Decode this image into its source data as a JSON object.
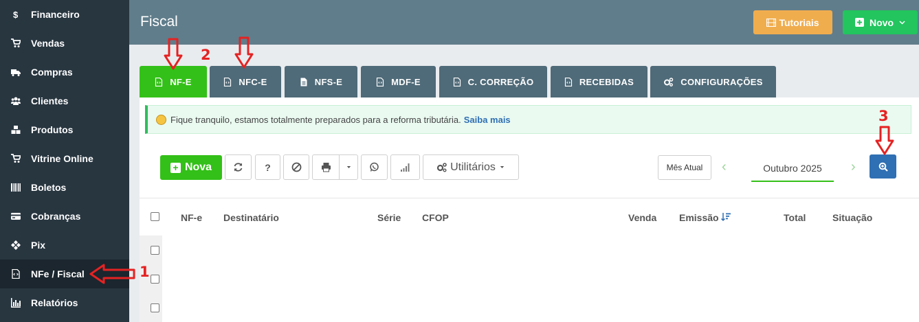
{
  "sidebar": {
    "items": [
      {
        "label": "Financeiro",
        "icon": "dollar-icon"
      },
      {
        "label": "Vendas",
        "icon": "cart-icon"
      },
      {
        "label": "Compras",
        "icon": "truck-icon"
      },
      {
        "label": "Clientes",
        "icon": "users-icon"
      },
      {
        "label": "Produtos",
        "icon": "cubes-icon"
      },
      {
        "label": "Vitrine Online",
        "icon": "cart-icon"
      },
      {
        "label": "Boletos",
        "icon": "barcode-icon"
      },
      {
        "label": "Cobranças",
        "icon": "credit-card-icon"
      },
      {
        "label": "Pix",
        "icon": "pix-icon"
      },
      {
        "label": "NFe / Fiscal",
        "icon": "file-code-icon",
        "active": true
      },
      {
        "label": "Relatórios",
        "icon": "bar-chart-icon"
      }
    ]
  },
  "header": {
    "title": "Fiscal",
    "tutoriais_label": "Tutoriais",
    "novo_label": "Novo"
  },
  "tabs": [
    {
      "label": "NF-E",
      "active": true
    },
    {
      "label": "NFC-E"
    },
    {
      "label": "NFS-E"
    },
    {
      "label": "MDF-E"
    },
    {
      "label": "C. CORREÇÃO"
    },
    {
      "label": "RECEBIDAS"
    },
    {
      "label": "CONFIGURAÇÕES"
    }
  ],
  "alert": {
    "text": "Fique tranquilo, estamos totalmente preparados para a reforma tributária.",
    "link": "Saiba mais"
  },
  "toolbar": {
    "nova_label": "Nova",
    "help_label": "?",
    "utilitarios_label": "Utilitários",
    "mes_atual_label": "Mês Atual",
    "month": "Outubro 2025",
    "prev": "‹",
    "next": "›"
  },
  "table": {
    "columns": [
      "NF-e",
      "Destinatário",
      "Série",
      "CFOP",
      "Venda",
      "Emissão",
      "Total",
      "Situação"
    ]
  },
  "annotations": {
    "n1": "1",
    "n2": "2",
    "n3": "3"
  },
  "colors": {
    "sidebar_bg": "#283640",
    "header_bg": "#607d8b",
    "tab_bg": "#4f6a78",
    "tab_active": "#33c018",
    "accent_blue": "#2f6fb3",
    "tutoriais": "#f0ad4e",
    "novo": "#22c55e",
    "annotation_red": "#e52222"
  }
}
